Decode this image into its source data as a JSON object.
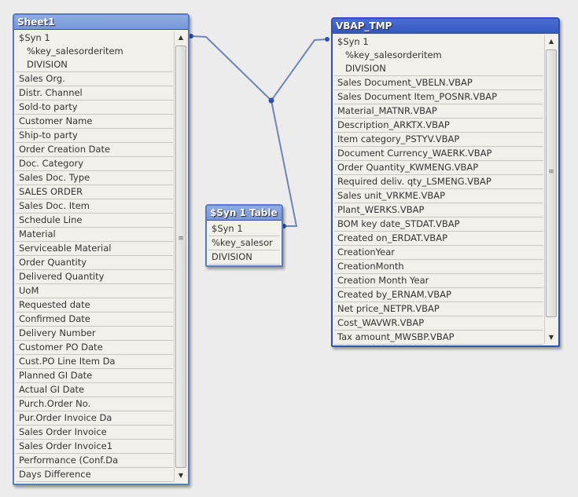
{
  "tables": {
    "sheet1": {
      "title": "Sheet1",
      "fields": [
        "$Syn 1",
        "%key_salesorderitem",
        "DIVISION",
        "Sales Org.",
        "Distr. Channel",
        "Sold-to party",
        "Customer Name",
        "Ship-to party",
        "Order Creation Date",
        "Doc. Category",
        "Sales Doc. Type",
        "SALES ORDER",
        "Sales Doc. Item",
        "Schedule Line",
        "Material",
        "Serviceable Material",
        "Order Quantity",
        "Delivered Quantity",
        "UoM",
        "Requested date",
        "Confirmed Date",
        "Delivery Number",
        "Customer PO Date",
        "Cust.PO Line Item Da",
        "Planned GI Date",
        "Actual GI Date",
        "Purch.Order No.",
        "Pur.Order Invoice Da",
        "Sales Order Invoice",
        "Sales Order Invoice1",
        "Performance (Conf.Da",
        "Days Difference"
      ]
    },
    "syn": {
      "title": "$Syn 1 Table",
      "fields": [
        "$Syn 1",
        "%key_salesor",
        "DIVISION"
      ]
    },
    "vbap": {
      "title": "VBAP_TMP",
      "fields": [
        "$Syn 1",
        "%key_salesorderitem",
        "DIVISION",
        "Sales Document_VBELN.VBAP",
        "Sales Document Item_POSNR.VBAP",
        "Material_MATNR.VBAP",
        "Description_ARKTX.VBAP",
        "Item category_PSTYV.VBAP",
        "Document Currency_WAERK.VBAP",
        "Order Quantity_KWMENG.VBAP",
        "Required deliv. qty_LSMENG.VBAP",
        "Sales unit_VRKME.VBAP",
        "Plant_WERKS.VBAP",
        "BOM key date_STDAT.VBAP",
        "Created on_ERDAT.VBAP",
        "CreationYear",
        "CreationMonth",
        "Creation Month Year",
        "Created by_ERNAM.VBAP",
        "Net price_NETPR.VBAP",
        "Cost_WAVWR.VBAP",
        "Tax amount_MWSBP.VBAP"
      ]
    }
  },
  "colors": {
    "title_inactive": "#7f9dd9",
    "title_active": "#3b5fc9",
    "link": "#6f84b8"
  }
}
